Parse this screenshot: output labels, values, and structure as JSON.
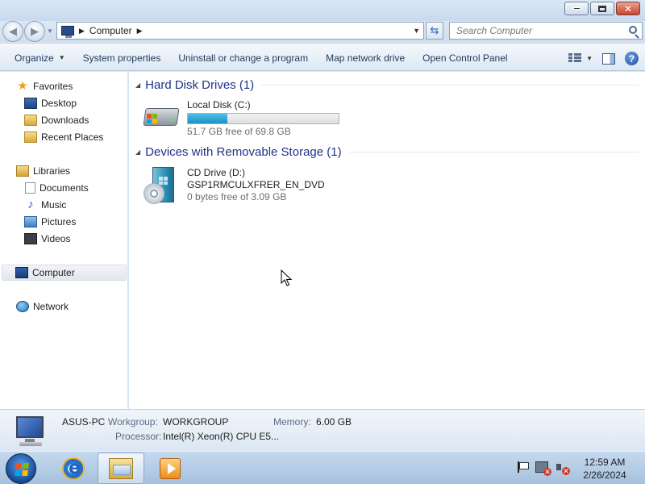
{
  "address": {
    "path": [
      "Computer"
    ],
    "search_placeholder": "Search Computer"
  },
  "toolbar": {
    "organize": "Organize",
    "system_properties": "System properties",
    "uninstall": "Uninstall or change a program",
    "map_drive": "Map network drive",
    "control_panel": "Open Control Panel"
  },
  "sidebar": {
    "favorites": "Favorites",
    "desktop": "Desktop",
    "downloads": "Downloads",
    "recent_places": "Recent Places",
    "libraries": "Libraries",
    "documents": "Documents",
    "music": "Music",
    "pictures": "Pictures",
    "videos": "Videos",
    "computer": "Computer",
    "network": "Network"
  },
  "groups": {
    "hdd": {
      "title": "Hard Disk Drives (1)",
      "drive_name": "Local Disk (C:)",
      "free_text": "51.7 GB free of 69.8 GB",
      "used_fraction": 0.26
    },
    "removable": {
      "title": "Devices with Removable Storage (1)",
      "drive_name": "CD Drive (D:)",
      "label": "GSP1RMCULXFRER_EN_DVD",
      "free_text": "0 bytes free of 3.09 GB"
    }
  },
  "details": {
    "pc_name": "ASUS-PC",
    "workgroup_label": "Workgroup:",
    "workgroup": "WORKGROUP",
    "memory_label": "Memory:",
    "memory": "6.00 GB",
    "processor_label": "Processor:",
    "processor": "Intel(R) Xeon(R) CPU E5..."
  },
  "taskbar": {
    "time": "12:59 AM",
    "date": "2/26/2024"
  },
  "colors": {
    "group_title": "#1e3287",
    "progress": "#1e8fc4",
    "taskbar": "#a6c1de"
  }
}
